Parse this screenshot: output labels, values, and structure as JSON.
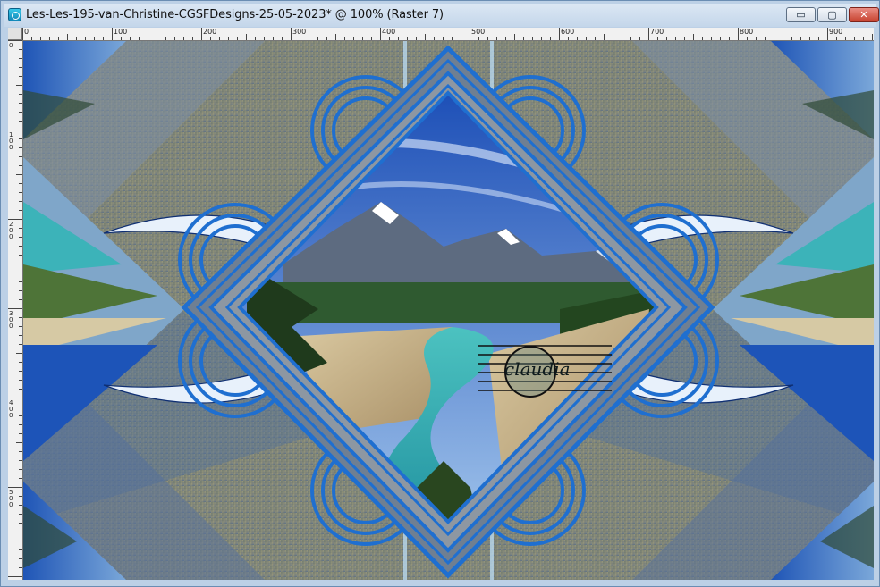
{
  "window": {
    "title": "Les-Les-195-van-Christine-CGSFDesigns-25-05-2023* @ 100% (Raster 7)",
    "buttons": {
      "minimize": "▭",
      "maximize": "▢",
      "close": "✕"
    }
  },
  "ruler": {
    "top_labels": [
      "0",
      "100",
      "200",
      "300",
      "400",
      "500",
      "600",
      "700",
      "800",
      "900"
    ],
    "left_labels": [
      "0",
      "100",
      "200",
      "300",
      "400",
      "500"
    ]
  },
  "canvas": {
    "watermark_text": "claudia",
    "accent_color": "#1f6fd0",
    "sky_color": "#2f6fd0",
    "river_color": "#3bbcc0"
  }
}
